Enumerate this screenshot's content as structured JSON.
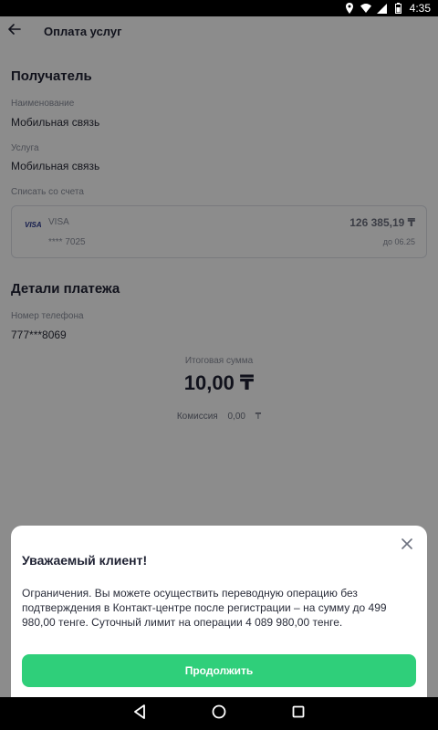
{
  "status_bar": {
    "time": "4:35"
  },
  "header": {
    "title": "Оплата услуг"
  },
  "recipient": {
    "section_title": "Получатель",
    "name_label": "Наименование",
    "name_value": "Мобильная связь",
    "service_label": "Услуга",
    "service_value": "Мобильная связь",
    "account_label": "Списать со счета"
  },
  "card": {
    "logo_text": "VISA",
    "name": "VISA",
    "masked_number": "**** 7025",
    "balance": "126 385,19 ₸",
    "expiry": "до 06.25"
  },
  "payment_details": {
    "section_title": "Детали платежа",
    "phone_label": "Номер телефона",
    "phone_value": "777***8069"
  },
  "summary": {
    "total_label": "Итоговая сумма",
    "total_amount": "10,00 ₸",
    "commission_label": "Комиссия",
    "commission_value": "0,00",
    "commission_currency": "₸"
  },
  "dialog": {
    "title": "Уважаемый клиент!",
    "message": "Ограничения. Вы можете осуществить переводную операцию без подтверждения в Контакт-центре после регистрации – на сумму до 499 980,00 тенге. Суточный лимит на операции 4 089 980,00 тенге.",
    "continue_label": "Продолжить"
  },
  "colors": {
    "accent": "#2fcf7a",
    "overlay": "rgba(0,0,0,0.45)"
  },
  "icons": {
    "back": "arrow-left-icon",
    "close": "close-icon",
    "nav_back": "triangle-back-icon",
    "nav_home": "circle-home-icon",
    "nav_recents": "square-recents-icon"
  }
}
